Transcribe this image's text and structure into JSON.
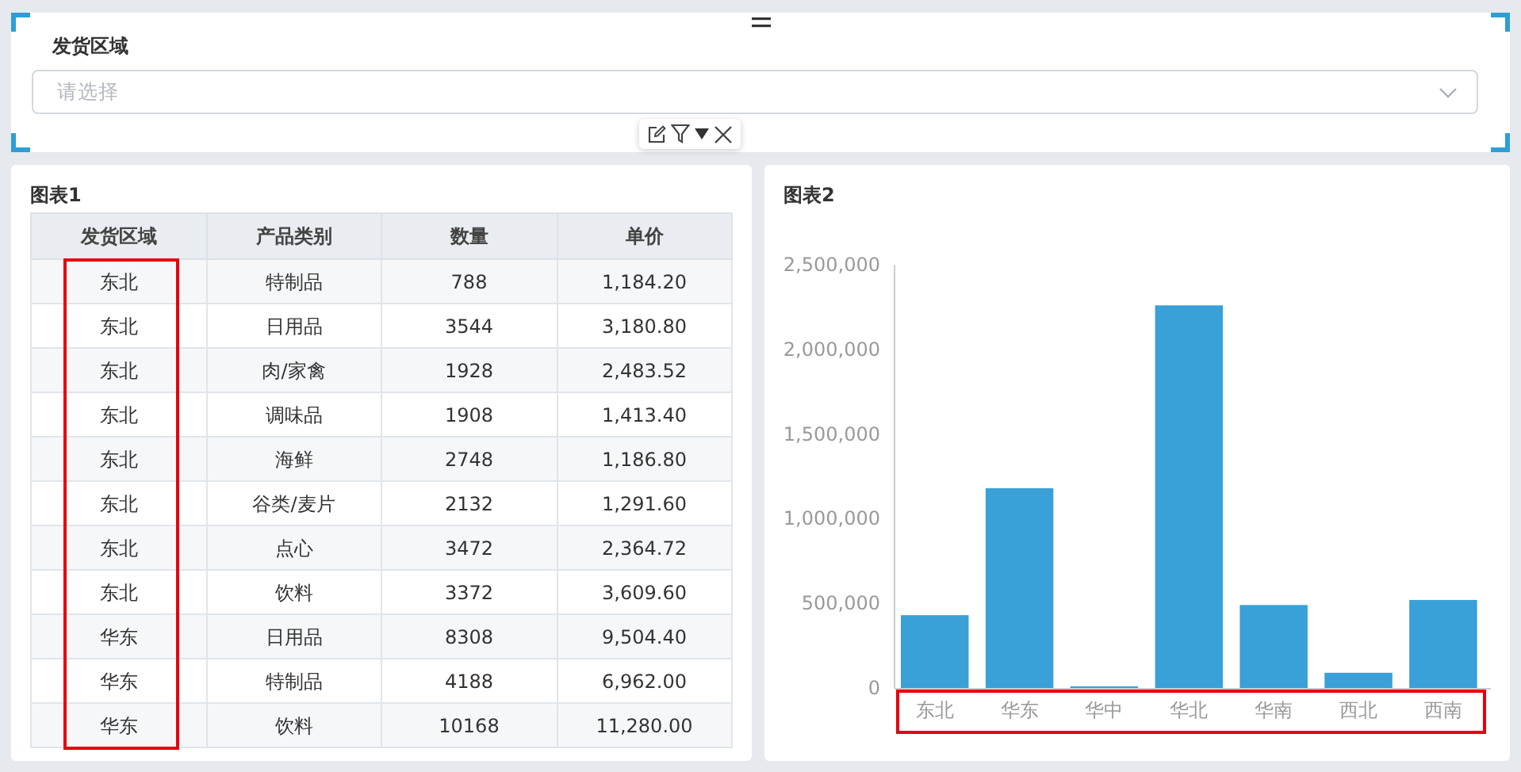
{
  "filter": {
    "label": "发货区域",
    "placeholder": "请选择",
    "selected": true
  },
  "table_panel": {
    "title": "图表1",
    "first_column_highlighted": true,
    "columns": [
      {
        "label": "发货区域"
      },
      {
        "label": "产品类别"
      },
      {
        "label": "数量"
      },
      {
        "label": "单价"
      }
    ],
    "rows": [
      [
        "东北",
        "特制品",
        "788",
        "1,184.20"
      ],
      [
        "东北",
        "日用品",
        "3544",
        "3,180.80"
      ],
      [
        "东北",
        "肉/家禽",
        "1928",
        "2,483.52"
      ],
      [
        "东北",
        "调味品",
        "1908",
        "1,413.40"
      ],
      [
        "东北",
        "海鲜",
        "2748",
        "1,186.80"
      ],
      [
        "东北",
        "谷类/麦片",
        "2132",
        "1,291.60"
      ],
      [
        "东北",
        "点心",
        "3472",
        "2,364.72"
      ],
      [
        "东北",
        "饮料",
        "3372",
        "3,609.60"
      ],
      [
        "华东",
        "日用品",
        "8308",
        "9,504.40"
      ],
      [
        "华东",
        "特制品",
        "4188",
        "6,962.00"
      ],
      [
        "华东",
        "饮料",
        "10168",
        "11,280.00"
      ]
    ]
  },
  "chart_panel": {
    "title": "图表2",
    "categories_highlighted": true,
    "chart_data": {
      "type": "bar",
      "categories": [
        "东北",
        "华东",
        "华中",
        "华北",
        "华南",
        "西北",
        "西南"
      ],
      "series": [
        {
          "color": "#3aa0d8",
          "values": [
            430000,
            1180000,
            10000,
            2260000,
            490000,
            90000,
            520000
          ]
        }
      ],
      "ylim": [
        0,
        2500000
      ],
      "yticks": [
        {
          "value": 0,
          "label": "0"
        },
        {
          "value": 500000,
          "label": "500,000"
        },
        {
          "value": 1000000,
          "label": "1,000,000"
        },
        {
          "value": 1500000,
          "label": "1,500,000"
        },
        {
          "value": 2000000,
          "label": "2,000,000"
        },
        {
          "value": 2500000,
          "label": "2,500,000"
        }
      ]
    }
  }
}
